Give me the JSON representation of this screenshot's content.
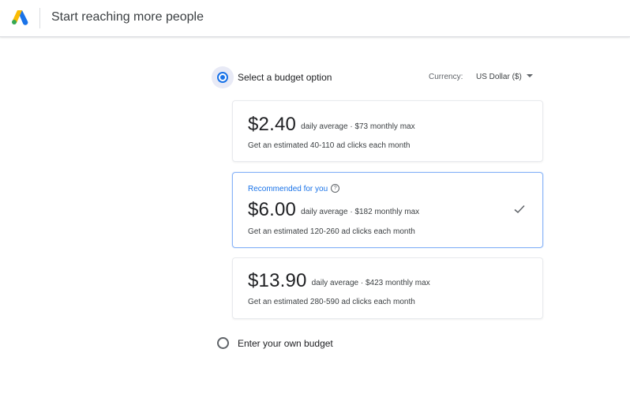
{
  "header": {
    "title": "Start reaching more people",
    "logo_icon": "google-ads-logo"
  },
  "budget_option": {
    "label": "Select a budget option",
    "selected": true,
    "currency_label": "Currency:",
    "currency_value": "US Dollar ($)"
  },
  "options": [
    {
      "price": "$2.40",
      "daily": "daily average ·",
      "monthly": "$73 monthly max",
      "estimate": "Get an estimated 40-110 ad clicks each month",
      "recommended": false
    },
    {
      "recommended_label": "Recommended for you",
      "help_icon": "?",
      "price": "$6.00",
      "daily": "daily average ·",
      "monthly": "$182 monthly max",
      "estimate": "Get an estimated 120-260 ad clicks each month",
      "recommended": true,
      "selected_icon": "check-icon"
    },
    {
      "price": "$13.90",
      "daily": "daily average ·",
      "monthly": "$423 monthly max",
      "estimate": "Get an estimated 280-590 ad clicks each month",
      "recommended": false
    }
  ],
  "own_budget": {
    "label": "Enter your own budget",
    "selected": false
  },
  "colors": {
    "accent": "#1a73e8",
    "text": "#202124",
    "border": "#dadce0"
  }
}
